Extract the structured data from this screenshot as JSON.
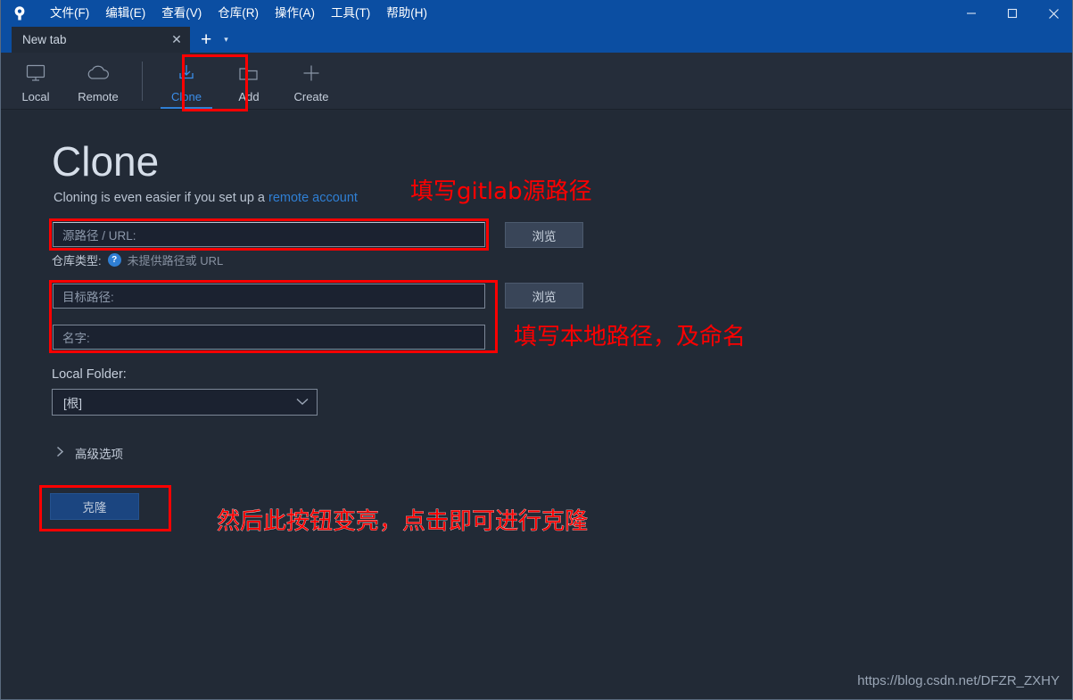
{
  "window": {
    "app_logo_icon": "sourcetree-logo-icon",
    "minimize_icon": "minimize-icon",
    "maximize_icon": "maximize-icon",
    "close_icon": "close-icon",
    "titlebar_color": "#0b4ea2"
  },
  "menubar": {
    "items": [
      {
        "label": "文件(F)"
      },
      {
        "label": "编辑(E)"
      },
      {
        "label": "查看(V)"
      },
      {
        "label": "仓库(R)"
      },
      {
        "label": "操作(A)"
      },
      {
        "label": "工具(T)"
      },
      {
        "label": "帮助(H)"
      }
    ]
  },
  "tabs": {
    "active_tab_label": "New tab",
    "close_icon_glyph": "✕",
    "new_tab_glyph": "+",
    "dropdown_glyph": "▾"
  },
  "toolbar": {
    "buttons": [
      {
        "label": "Local",
        "icon": "monitor-icon",
        "active": false
      },
      {
        "label": "Remote",
        "icon": "cloud-icon",
        "active": false
      },
      {
        "label": "Clone",
        "icon": "download-icon",
        "active": true
      },
      {
        "label": "Add",
        "icon": "folder-icon",
        "active": false
      },
      {
        "label": "Create",
        "icon": "plus-icon",
        "active": false
      }
    ],
    "accent_color": "#3b8eea"
  },
  "main": {
    "title": "Clone",
    "subtitle_prefix": "Cloning is even easier if you set up a ",
    "subtitle_link": "remote account",
    "source_path": {
      "placeholder": "源路径 / URL:",
      "value": ""
    },
    "source_browse_label": "浏览",
    "repo_type": {
      "label": "仓库类型:",
      "help_icon": "question-mark-icon",
      "message": "未提供路径或 URL"
    },
    "dest_path": {
      "placeholder": "目标路径:",
      "value": ""
    },
    "dest_browse_label": "浏览",
    "name_field": {
      "placeholder": "名字:",
      "value": ""
    },
    "local_folder_label": "Local Folder:",
    "local_folder_value": "[根]",
    "local_folder_chevron": "⌄",
    "advanced_label": "高级选项",
    "advanced_chevron": "❯",
    "clone_button_label": "克隆"
  },
  "annotations": {
    "color": "#fe0000",
    "note_source": "填写gitlab源路径",
    "note_local": "填写本地路径，及命名",
    "note_clone": "然后此按钮变亮，点击即可进行克隆"
  },
  "watermark": {
    "text": "https://blog.csdn.net/DFZR_ZXHY"
  }
}
